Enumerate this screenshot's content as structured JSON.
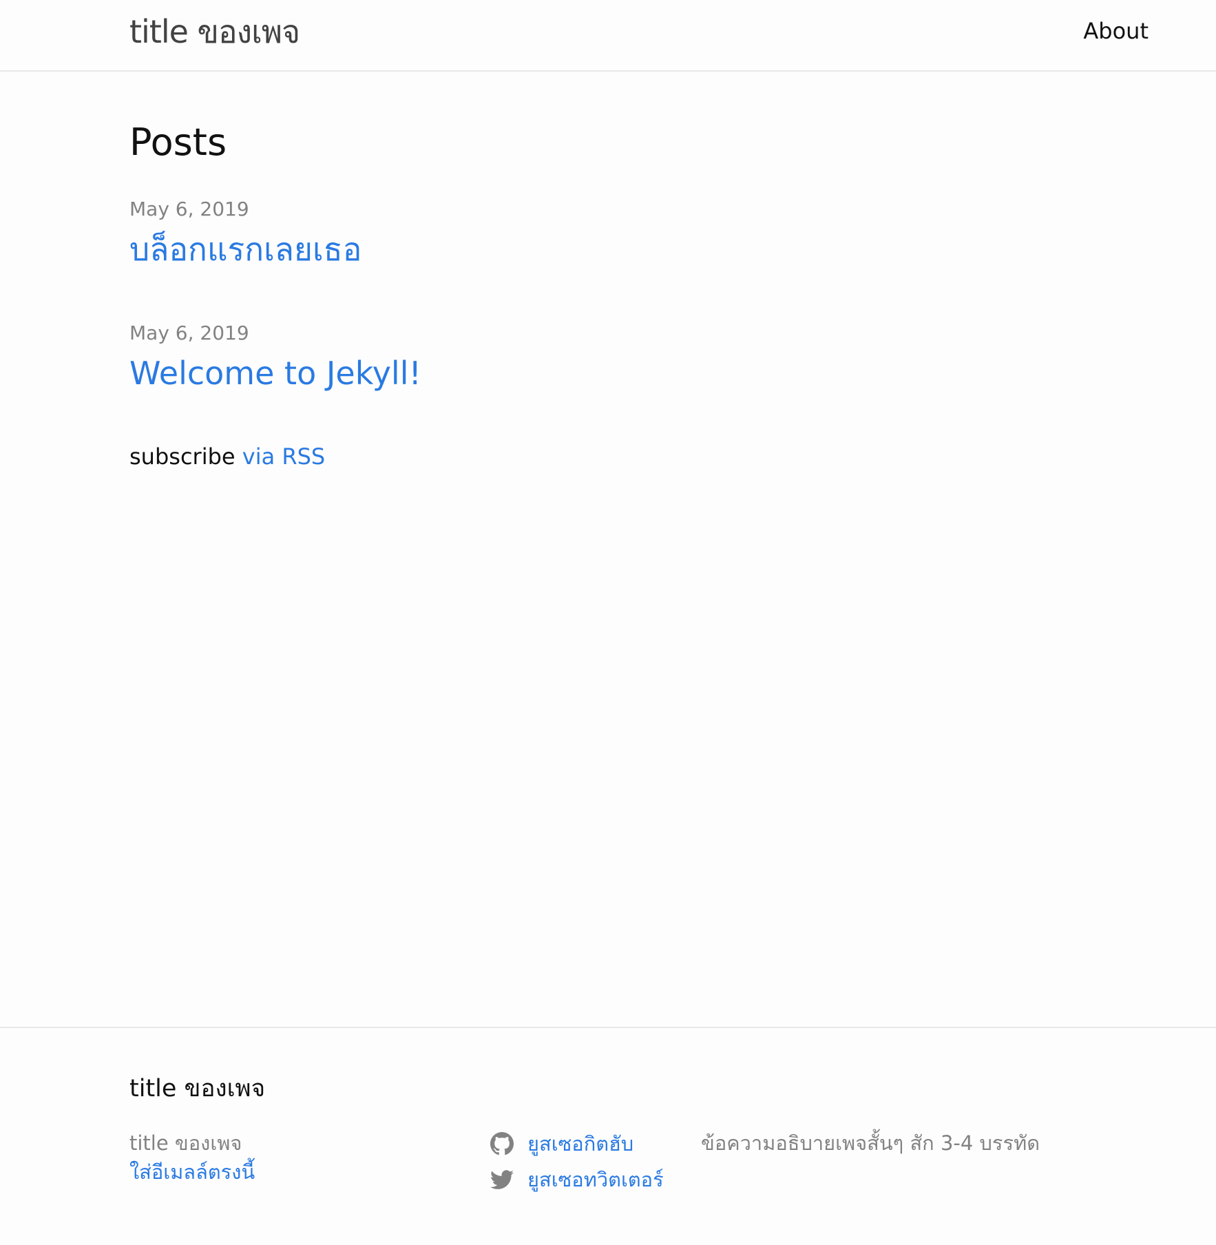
{
  "header": {
    "site_title": "title ของเพจ",
    "nav": [
      {
        "label": "About"
      }
    ]
  },
  "main": {
    "heading": "Posts",
    "posts": [
      {
        "date": "May 6, 2019",
        "title": "บล็อกแรกเลยเธอ"
      },
      {
        "date": "May 6, 2019",
        "title": "Welcome to Jekyll!"
      }
    ],
    "rss": {
      "prefix": "subscribe",
      "link_label": "via RSS"
    }
  },
  "footer": {
    "heading": "title ของเพจ",
    "name": "title ของเพจ",
    "email": "ใส่อีเมลล์ตรงนี้",
    "social": [
      {
        "icon": "github-icon",
        "label": "ยูสเซอกิตฮับ"
      },
      {
        "icon": "twitter-icon",
        "label": "ยูสเซอทวิตเตอร์"
      }
    ],
    "description": "ข้อความอธิบายเพจสั้นๆ สัก 3-4 บรรทัด"
  },
  "colors": {
    "link": "#2a7ae2",
    "muted": "#828282",
    "text": "#111111",
    "border": "#e8e8e8",
    "background": "#fdfdfd"
  }
}
